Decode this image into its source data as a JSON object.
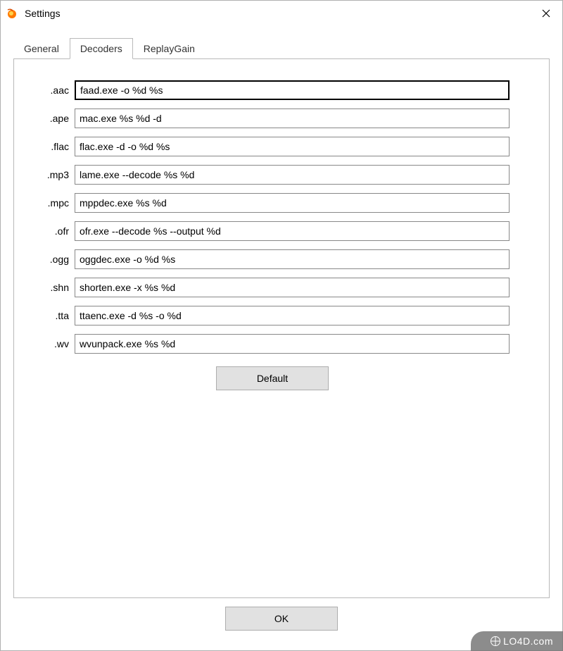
{
  "window": {
    "title": "Settings"
  },
  "tabs": [
    {
      "label": "General",
      "active": false
    },
    {
      "label": "Decoders",
      "active": true
    },
    {
      "label": "ReplayGain",
      "active": false
    }
  ],
  "decoders": [
    {
      "ext": ".aac",
      "cmd": "faad.exe -o %d %s"
    },
    {
      "ext": ".ape",
      "cmd": "mac.exe %s %d -d"
    },
    {
      "ext": ".flac",
      "cmd": "flac.exe -d -o %d %s"
    },
    {
      "ext": ".mp3",
      "cmd": "lame.exe --decode %s %d"
    },
    {
      "ext": ".mpc",
      "cmd": "mppdec.exe %s %d"
    },
    {
      "ext": ".ofr",
      "cmd": "ofr.exe --decode %s --output %d"
    },
    {
      "ext": ".ogg",
      "cmd": "oggdec.exe -o %d %s"
    },
    {
      "ext": ".shn",
      "cmd": "shorten.exe -x %s %d"
    },
    {
      "ext": ".tta",
      "cmd": "ttaenc.exe -d %s -o %d"
    },
    {
      "ext": ".wv",
      "cmd": "wvunpack.exe %s %d"
    }
  ],
  "buttons": {
    "default": "Default",
    "ok": "OK"
  },
  "watermark": "LO4D.com"
}
